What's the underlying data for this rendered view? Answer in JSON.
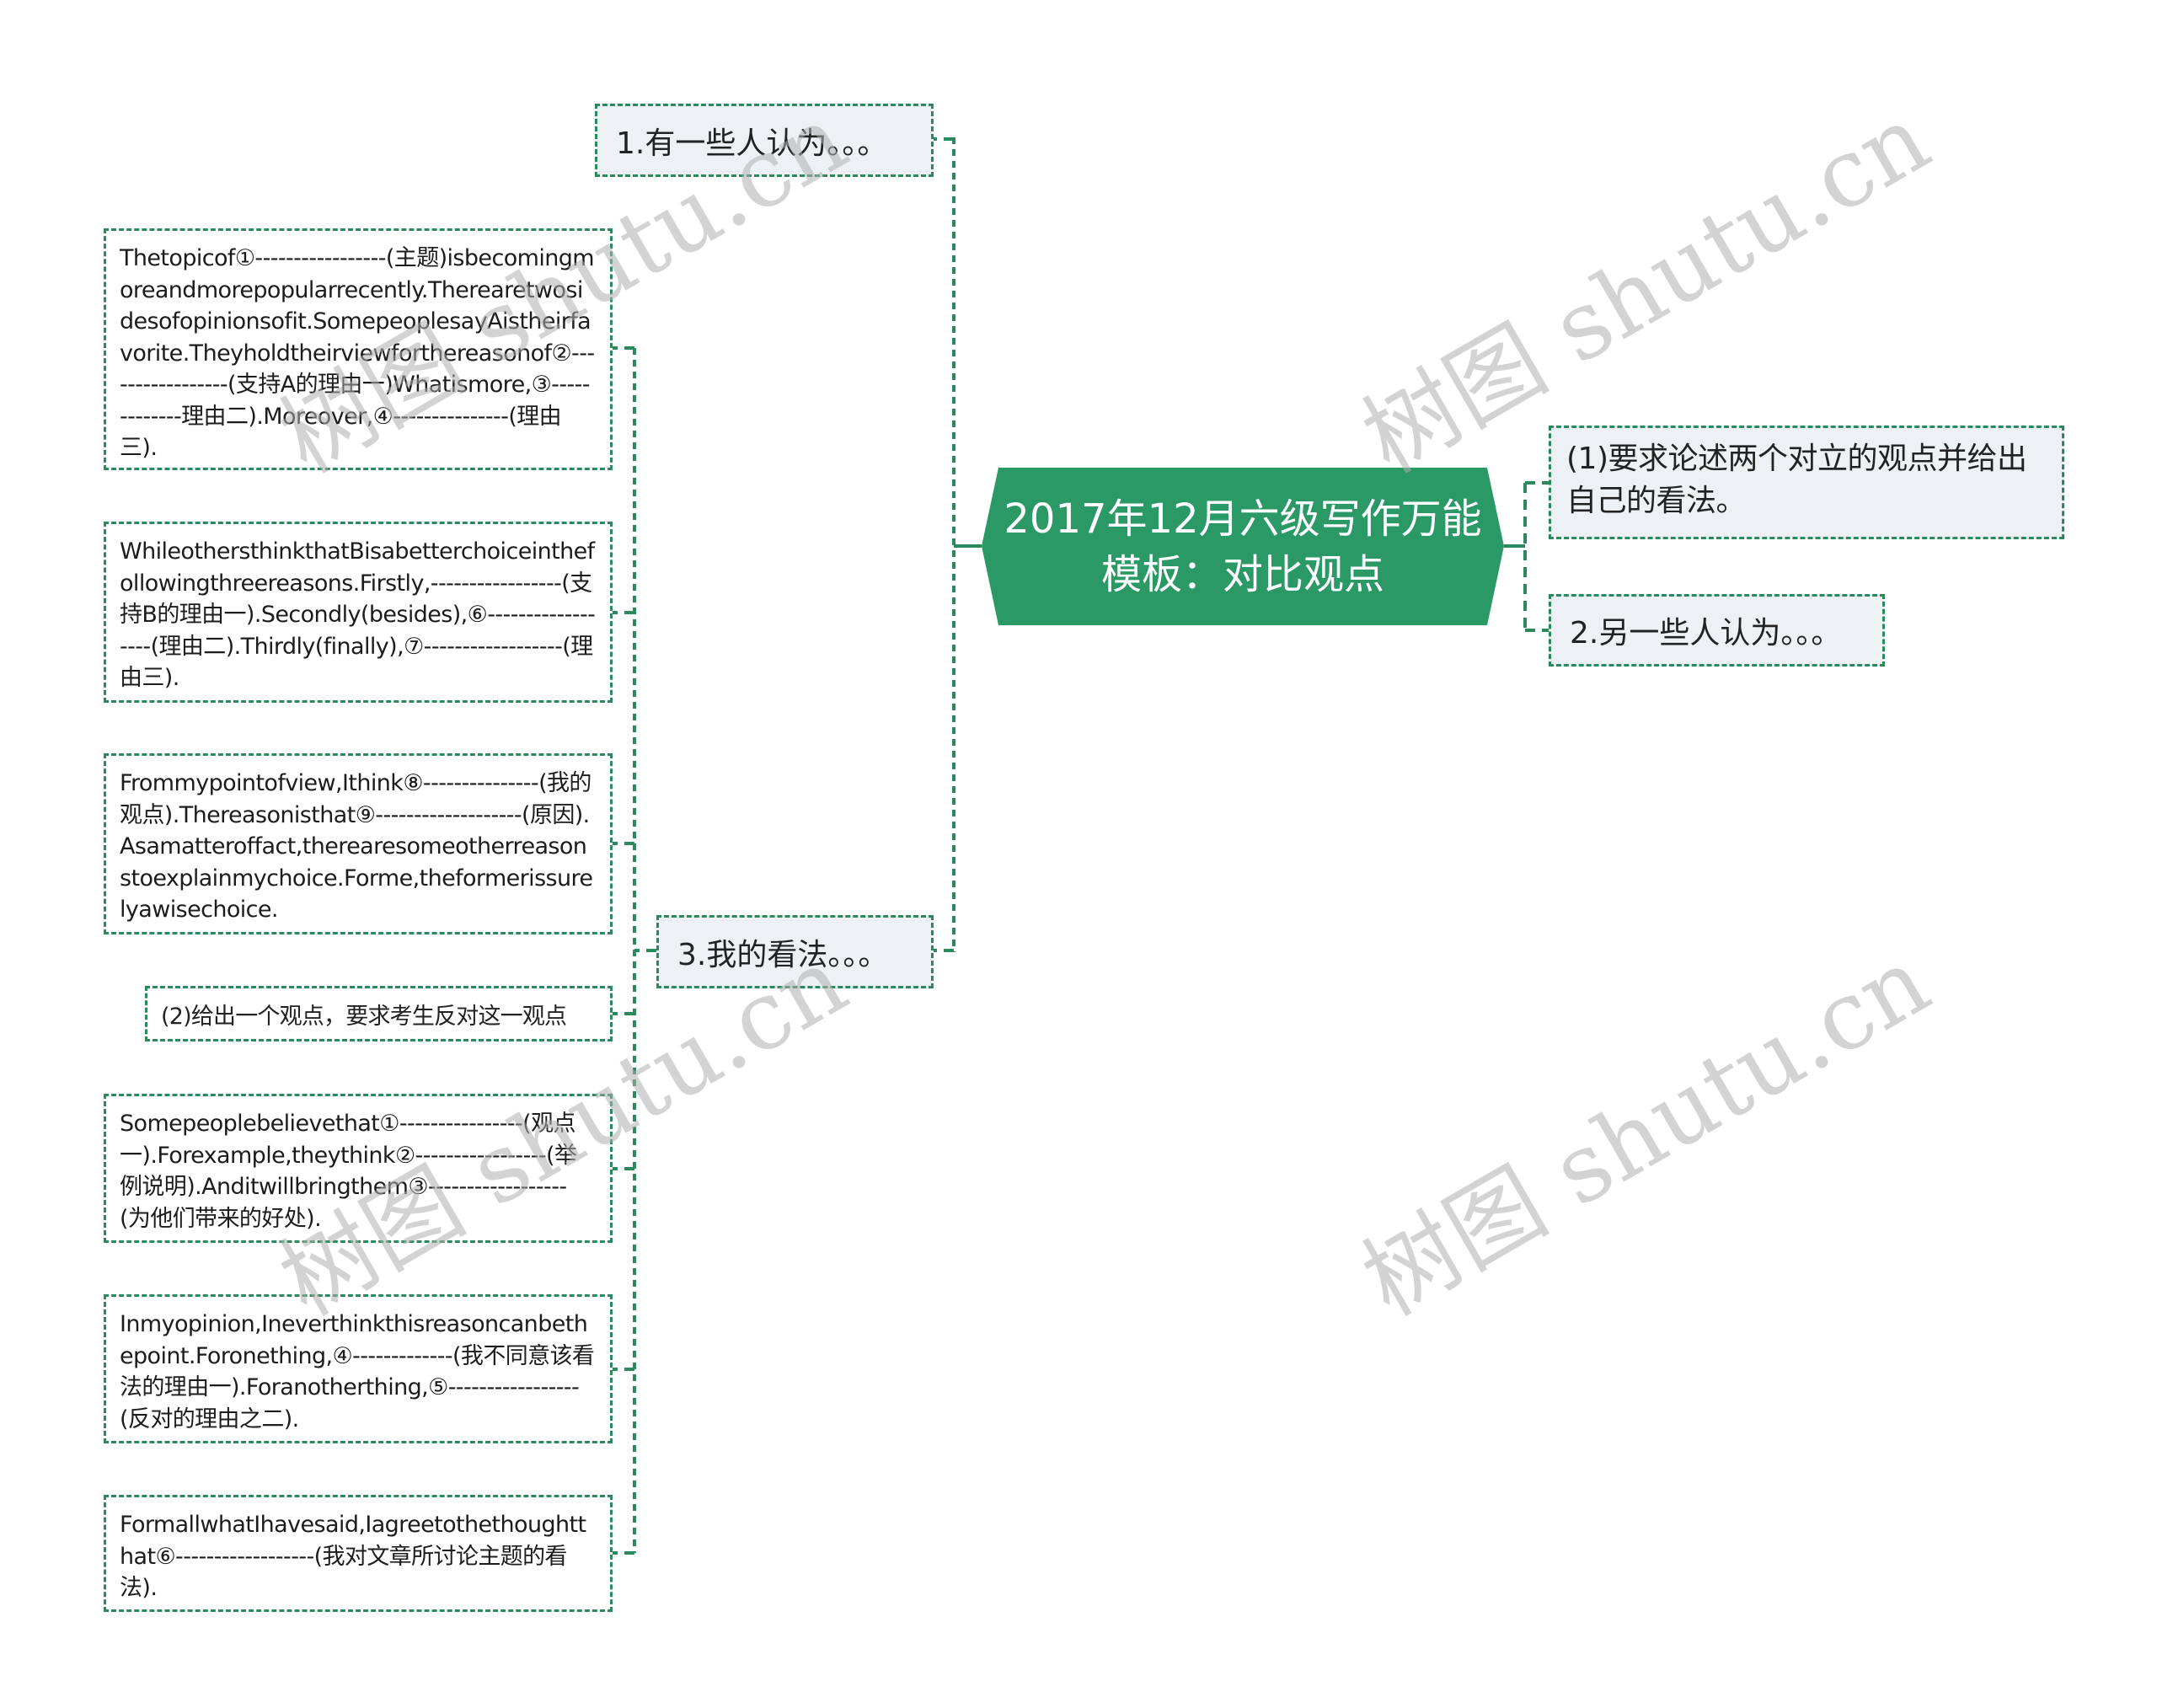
{
  "center": {
    "title_line1": "2017年12月六级写作万能",
    "title_line2": "模板：对比观点",
    "color": "#2a9966"
  },
  "left_branches": [
    {
      "label": "1.有一些人认为。。。",
      "children": []
    },
    {
      "label": "3.我的看法。。。",
      "children": [
        {
          "text": "Thetopicof①-----------------(主题)isbecomingmoreandmorepopularrecently.Therearetwosidesofopinionsofit.SomepeoplesayAistheirfavorite.Theyholdtheirviewforthereasonof②-----------------(支持A的理由一)Whatismore,③-------------理由二).Moreover,④---------------(理由三)."
        },
        {
          "text": "WhileothersthinkthatBisabetterchoiceinthefollowingthreereasons.Firstly,-----------------(支持B的理由一).Secondly(besides),⑥------------------(理由二).Thirdly(finally),⑦------------------(理由三)."
        },
        {
          "text": "Frommypointofview,Ithink⑧---------------(我的观点).Thereasonisthat⑨-------------------(原因).Asamatteroffact,therearesomeotherreasonstoexplainmychoice.Forme,theformerissurelyawisechoice."
        },
        {
          "text": "(2)给出一个观点，要求考生反对这一观点"
        },
        {
          "text": "Somepeoplebelievethat①----------------(观点一).Forexample,theythink②-----------------(举例说明).Anditwillbringthem③------------------(为他们带来的好处)."
        },
        {
          "text": "Inmyopinion,Ineverthinkthisreasoncanbethepoint.Foronething,④-------------(我不同意该看法的理由一).Foranotherthing,⑤-----------------(反对的理由之二)."
        },
        {
          "text": "FormallwhatIhavesaid,Iagreetothethoughtthat⑥------------------(我对文章所讨论主题的看法)."
        }
      ]
    }
  ],
  "right_branches": [
    {
      "label": "(1)要求论述两个对立的观点并给出自己的看法。"
    },
    {
      "label": "2.另一些人认为。。。"
    }
  ],
  "watermarks": [
    "树图 shutu.cn",
    "树图 shutu.cn",
    "树图 shutu.cn",
    "树图 shutu.cn"
  ],
  "colors": {
    "accent": "#2a8a5e",
    "topic_fill": "#eef1f4",
    "watermark": "#c8c8c8"
  }
}
